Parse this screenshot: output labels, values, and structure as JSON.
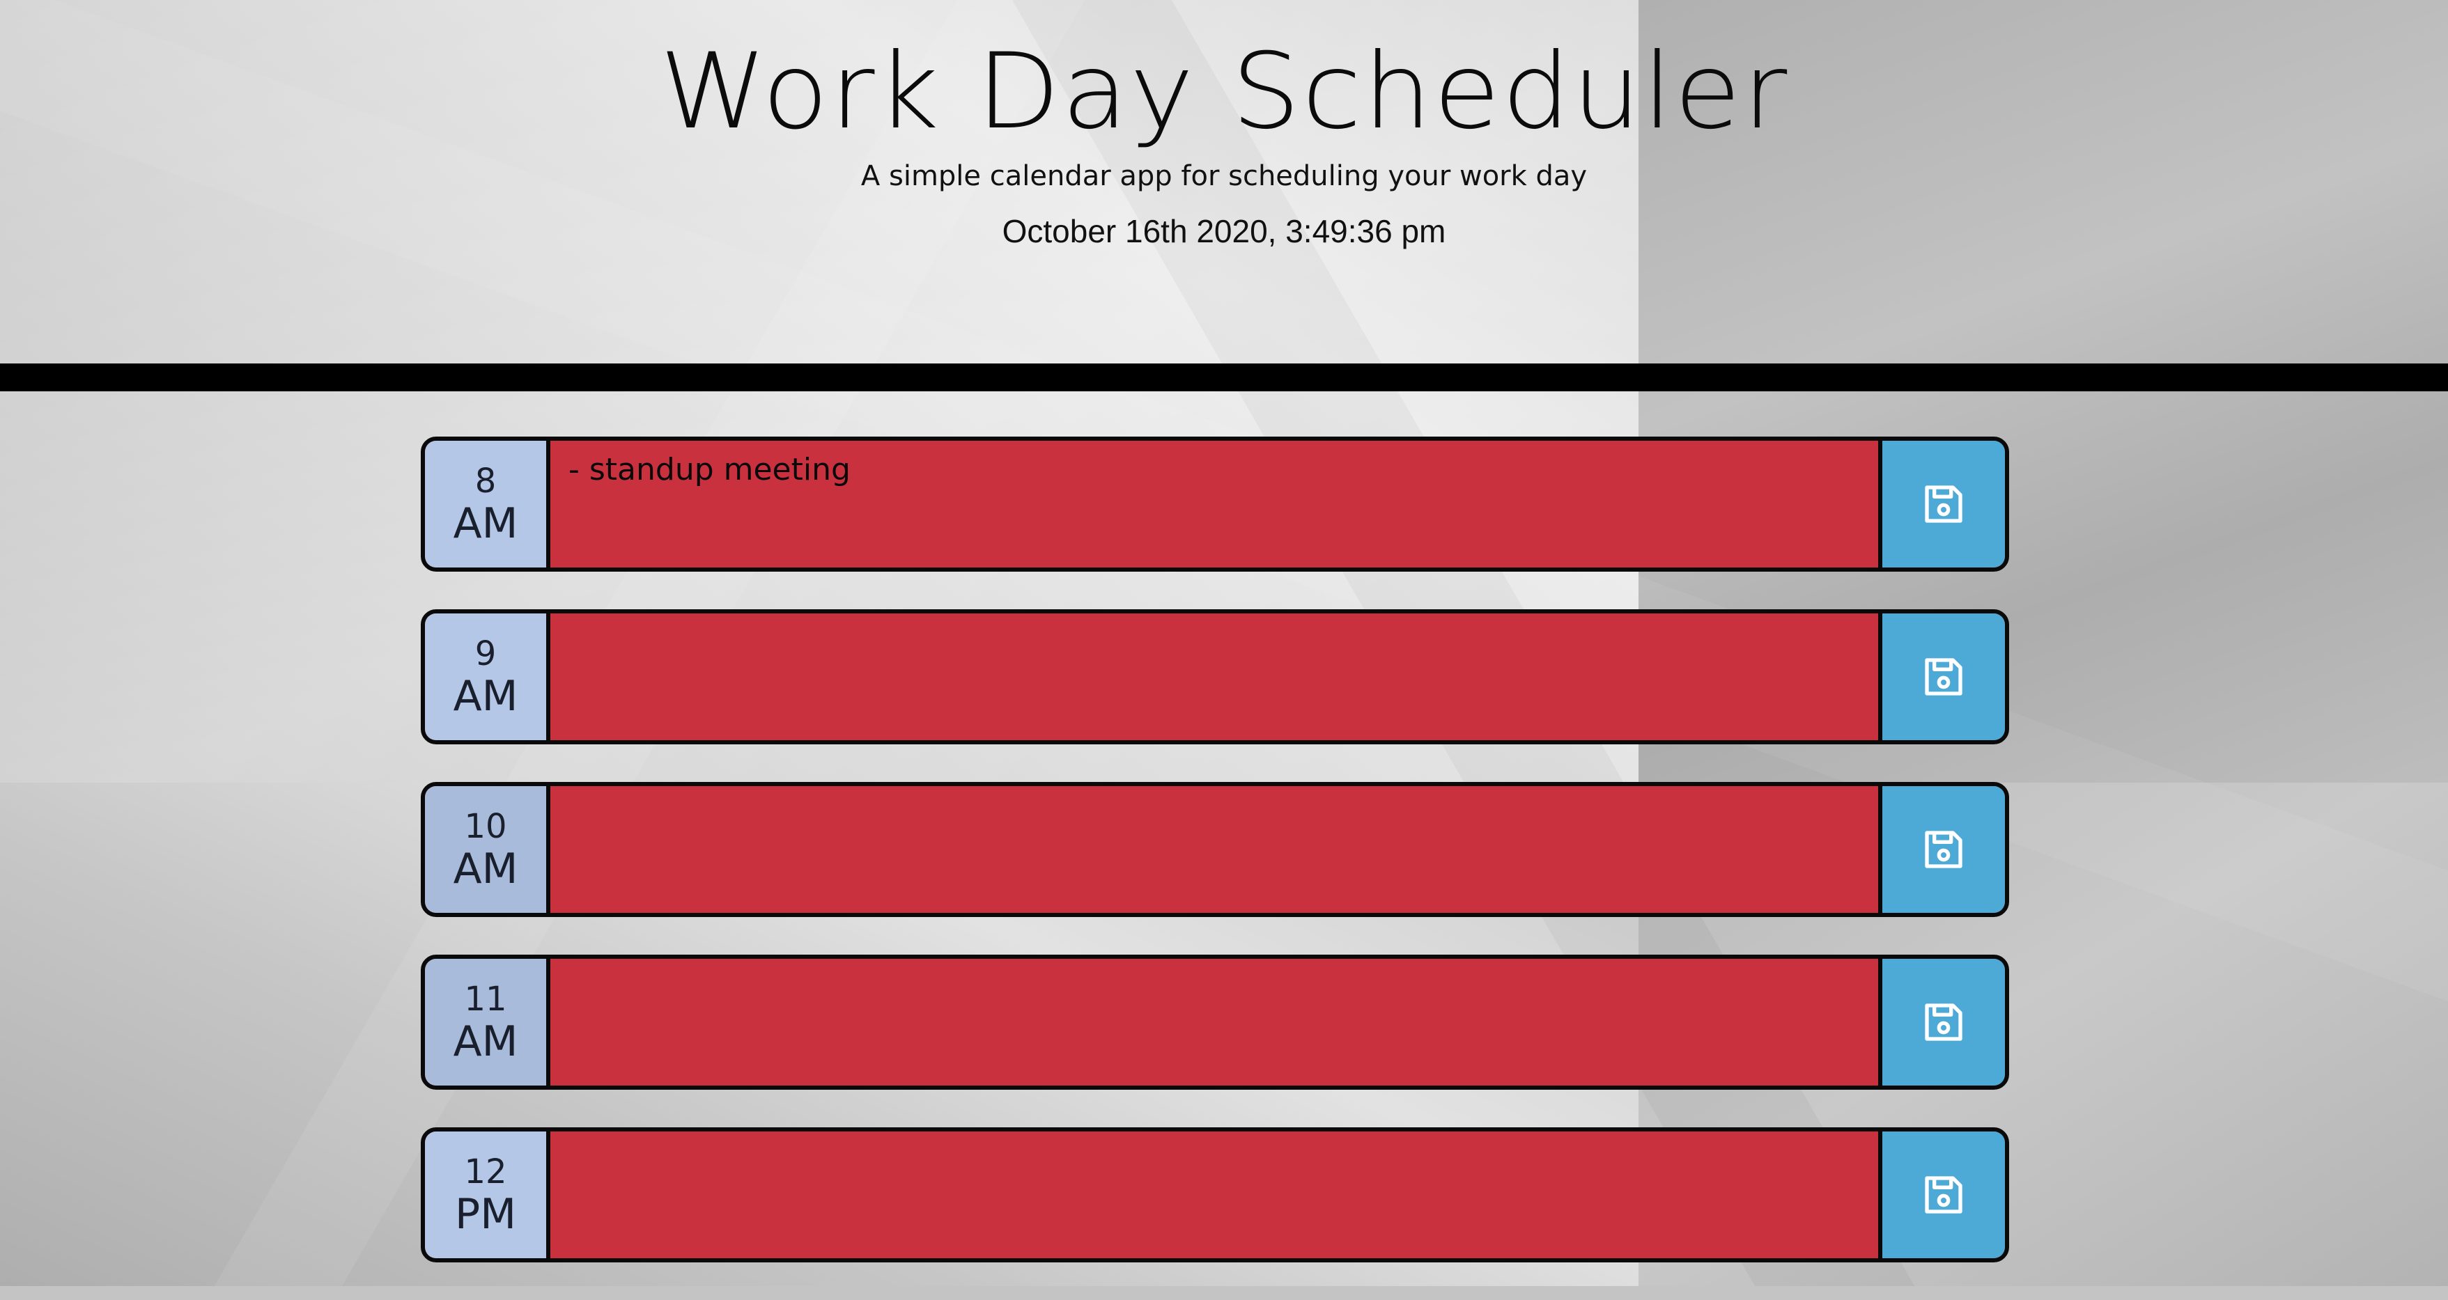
{
  "header": {
    "title": "Work Day Scheduler",
    "subtitle": "A simple calendar app for scheduling your work day",
    "datetime": "October 16th 2020, 3:49:36 pm"
  },
  "colors": {
    "header_bar": "#000000",
    "hour_block": "#b3c7e6",
    "past_row": "#c9313f",
    "save_button": "#4da9d6",
    "border": "#0a0a0a"
  },
  "schedule": {
    "rows": [
      {
        "hour": "8",
        "period": "AM",
        "description": "- standup meeting",
        "save_icon": "floppy-disk-icon"
      },
      {
        "hour": "9",
        "period": "AM",
        "description": "",
        "save_icon": "floppy-disk-icon"
      },
      {
        "hour": "10",
        "period": "AM",
        "description": "",
        "save_icon": "floppy-disk-icon"
      },
      {
        "hour": "11",
        "period": "AM",
        "description": "",
        "save_icon": "floppy-disk-icon"
      },
      {
        "hour": "12",
        "period": "PM",
        "description": "",
        "save_icon": "floppy-disk-icon"
      }
    ]
  }
}
